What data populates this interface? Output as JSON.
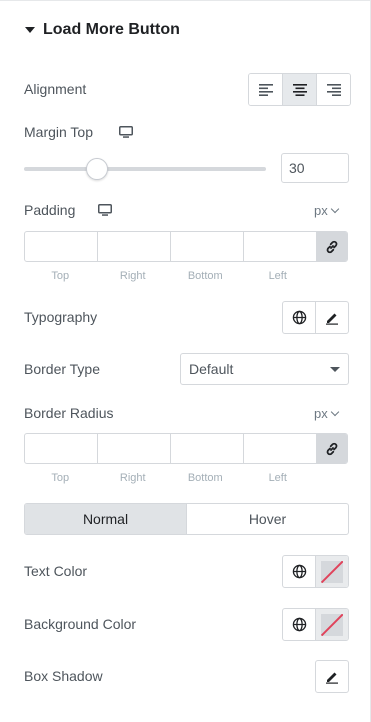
{
  "section": {
    "title": "Load More Button"
  },
  "alignment": {
    "label": "Alignment",
    "options": [
      "left",
      "center",
      "right"
    ],
    "selected": "center"
  },
  "margin_top": {
    "label": "Margin Top",
    "value": "30",
    "slider_fraction": 0.3
  },
  "padding": {
    "label": "Padding",
    "unit": "px",
    "sides": [
      "Top",
      "Right",
      "Bottom",
      "Left"
    ],
    "values": [
      "",
      "",
      "",
      ""
    ]
  },
  "typography": {
    "label": "Typography"
  },
  "border_type": {
    "label": "Border Type",
    "value": "Default"
  },
  "border_radius": {
    "label": "Border Radius",
    "unit": "px",
    "sides": [
      "Top",
      "Right",
      "Bottom",
      "Left"
    ],
    "values": [
      "",
      "",
      "",
      ""
    ]
  },
  "state_tabs": {
    "items": [
      "Normal",
      "Hover"
    ],
    "active": "Normal"
  },
  "text_color": {
    "label": "Text Color"
  },
  "background_color": {
    "label": "Background Color"
  },
  "box_shadow": {
    "label": "Box Shadow"
  },
  "colors": {
    "divider": "#d5d8dc",
    "active_bg": "#e6e9ec",
    "unset_slash": "#e0435b"
  }
}
